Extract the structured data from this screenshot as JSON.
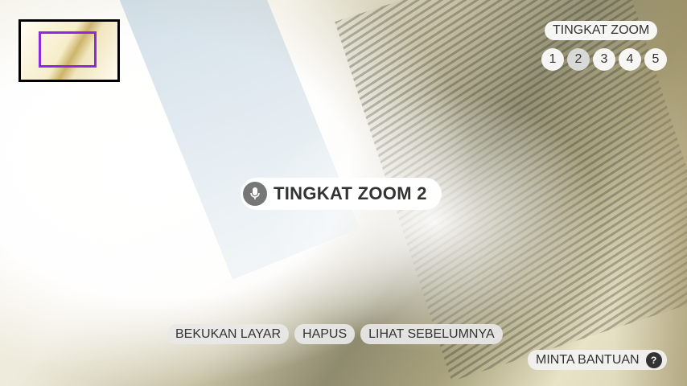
{
  "zoom": {
    "title": "TINGKAT ZOOM",
    "levels": [
      "1",
      "2",
      "3",
      "4",
      "5"
    ],
    "active_level": "2"
  },
  "status": {
    "text": "TINGKAT ZOOM 2",
    "icon": "microphone-icon"
  },
  "actions": {
    "freeze_label": "BEKUKAN LAYAR",
    "delete_label": "HAPUS",
    "previous_label": "LIHAT SEBELUMNYA"
  },
  "help": {
    "label": "MINTA BANTUAN",
    "icon": "question-icon",
    "icon_glyph": "?"
  },
  "colors": {
    "minimap_viewport": "#8a2be2",
    "minimap_border": "#000000"
  }
}
